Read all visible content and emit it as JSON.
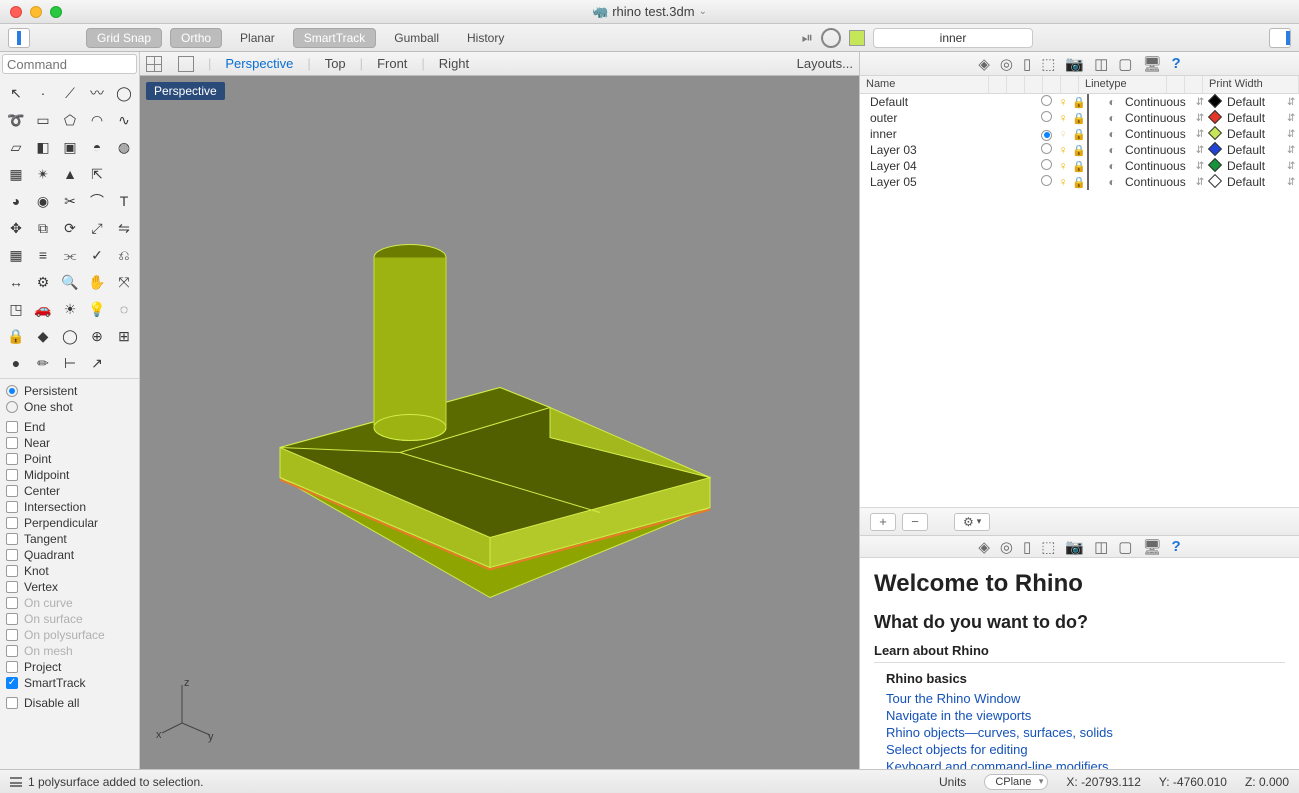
{
  "window": {
    "title": "rhino test.3dm"
  },
  "topbar": {
    "grid_snap": "Grid Snap",
    "ortho": "Ortho",
    "planar": "Planar",
    "smarttrack": "SmartTrack",
    "gumball": "Gumball",
    "history": "History",
    "layer_input": "inner"
  },
  "command_placeholder": "Command",
  "viewtabs": {
    "perspective": "Perspective",
    "top": "Top",
    "front": "Front",
    "right": "Right",
    "layouts": "Layouts..."
  },
  "viewport_label": "Perspective",
  "axes": {
    "x": "x",
    "y": "y",
    "z": "z"
  },
  "osnap": {
    "persistent": "Persistent",
    "oneshot": "One shot",
    "items": [
      {
        "label": "End",
        "on": false,
        "dim": false
      },
      {
        "label": "Near",
        "on": false,
        "dim": false
      },
      {
        "label": "Point",
        "on": false,
        "dim": false
      },
      {
        "label": "Midpoint",
        "on": false,
        "dim": false
      },
      {
        "label": "Center",
        "on": false,
        "dim": false
      },
      {
        "label": "Intersection",
        "on": false,
        "dim": false
      },
      {
        "label": "Perpendicular",
        "on": false,
        "dim": false
      },
      {
        "label": "Tangent",
        "on": false,
        "dim": false
      },
      {
        "label": "Quadrant",
        "on": false,
        "dim": false
      },
      {
        "label": "Knot",
        "on": false,
        "dim": false
      },
      {
        "label": "Vertex",
        "on": false,
        "dim": false
      },
      {
        "label": "On curve",
        "on": false,
        "dim": true
      },
      {
        "label": "On surface",
        "on": false,
        "dim": true
      },
      {
        "label": "On polysurface",
        "on": false,
        "dim": true
      },
      {
        "label": "On mesh",
        "on": false,
        "dim": true
      },
      {
        "label": "Project",
        "on": false,
        "dim": false
      },
      {
        "label": "SmartTrack",
        "on": true,
        "dim": false
      }
    ],
    "disable_all": "Disable all"
  },
  "layers": {
    "headers": {
      "name": "Name",
      "linetype": "Linetype",
      "printwidth": "Print Width"
    },
    "rows": [
      {
        "name": "Default",
        "current": false,
        "bulb": true,
        "color": "#000000",
        "dia": "#000000",
        "linetype": "Continuous",
        "printwidth": "Default"
      },
      {
        "name": "outer",
        "current": false,
        "bulb": true,
        "color": "#e33629",
        "dia": "#e33629",
        "linetype": "Continuous",
        "printwidth": "Default"
      },
      {
        "name": "inner",
        "current": true,
        "bulb": false,
        "color": "#c5e659",
        "dia": "#c5e659",
        "linetype": "Continuous",
        "printwidth": "Default"
      },
      {
        "name": "Layer 03",
        "current": false,
        "bulb": true,
        "color": "#2144d6",
        "dia": "#2144d6",
        "linetype": "Continuous",
        "printwidth": "Default"
      },
      {
        "name": "Layer 04",
        "current": false,
        "bulb": true,
        "color": "#17933a",
        "dia": "#17933a",
        "linetype": "Continuous",
        "printwidth": "Default"
      },
      {
        "name": "Layer 05",
        "current": false,
        "bulb": true,
        "color": "#ffffff",
        "dia": "#ffffff",
        "linetype": "Continuous",
        "printwidth": "Default"
      }
    ]
  },
  "help": {
    "title": "Welcome to Rhino",
    "subtitle": "What do you want to do?",
    "section": "Learn about Rhino",
    "basics": "Rhino basics",
    "links": [
      "Tour the Rhino Window",
      "Navigate in the viewports",
      "Rhino objects—curves, surfaces, solids",
      "Select objects for editing",
      "Keyboard and command-line modifiers"
    ]
  },
  "status": {
    "message": "1 polysurface added to selection.",
    "units": "Units",
    "cplane": "CPlane",
    "x": "X: -20793.112",
    "y": "Y: -4760.010",
    "z": "Z: 0.000"
  }
}
